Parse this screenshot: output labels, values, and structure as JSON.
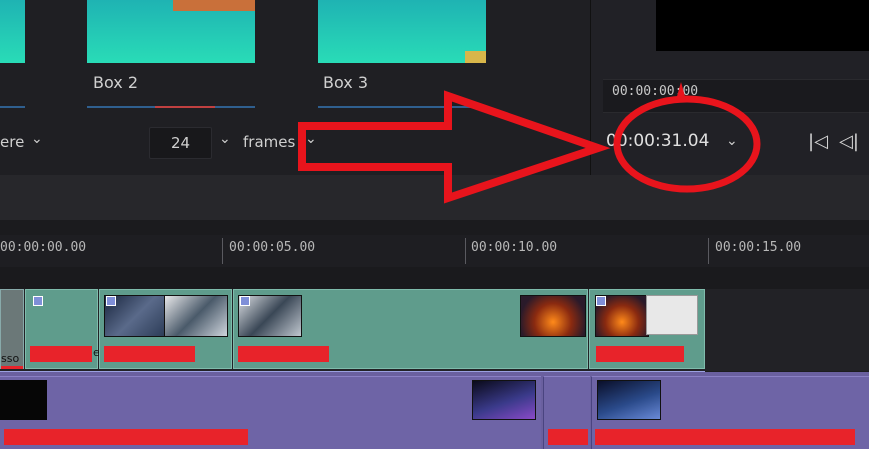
{
  "media_pool": {
    "box2_label": "Box 2",
    "box3_label": "Box 3"
  },
  "viewer": {
    "small_timecode": "00:00:00:00"
  },
  "toolbar": {
    "partial_dropdown_text": "ere",
    "frame_rate_value": "24",
    "frames_label": "frames",
    "timeline_duration": "00:00:31.04",
    "chevron": "⌄",
    "transport_prev_marker": "|◁",
    "transport_prev_frame": "◁|"
  },
  "ruler": {
    "labels": [
      "00:00:00.00",
      "00:00:05.00",
      "00:00:10.00",
      "00:00:15.00"
    ]
  },
  "tracks": {
    "partial_text": "sso",
    "partial_text2": "e"
  },
  "annotation": {
    "color": "#e8141c",
    "description_shapes": [
      "arrow",
      "ellipse"
    ]
  },
  "colors": {
    "accent_red": "#e8232a",
    "clip_green": "#5f9c8c",
    "clip_purple": "#6e64a6",
    "thumb_gradient_top": "#1fb3b3"
  }
}
